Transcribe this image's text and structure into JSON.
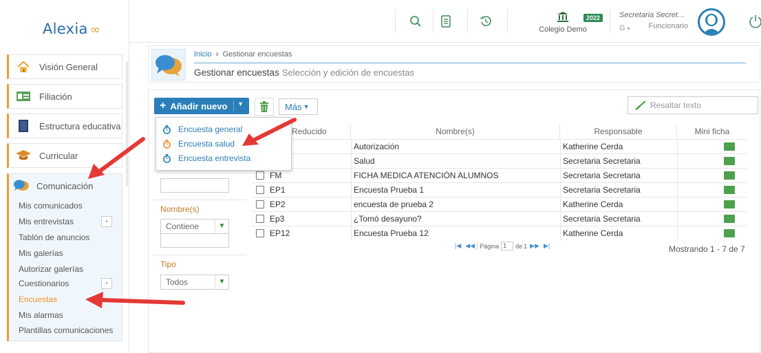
{
  "app": {
    "logo": "Alexia"
  },
  "sidebar": {
    "items": [
      {
        "label": "Visión General"
      },
      {
        "label": "Filiación"
      },
      {
        "label": "Estructura educativa"
      },
      {
        "label": "Curricular"
      }
    ],
    "comunicacion": {
      "label": "Comunicación",
      "subitems": [
        {
          "label": "Mis comunicados"
        },
        {
          "label": "Mis entrevistas"
        },
        {
          "label": "Tablón de anuncios"
        },
        {
          "label": "Mis galerías"
        },
        {
          "label": "Autorizar galerías"
        },
        {
          "label": "Cuestionarios"
        },
        {
          "label": "Encuestas"
        },
        {
          "label": "Mis alarmas"
        },
        {
          "label": "Plantillas comunicaciones"
        }
      ]
    }
  },
  "header": {
    "school_name": "Colegio Demo",
    "year": "2022",
    "user_name": "Secretaria Secretari...",
    "user_role": "Funcionario",
    "user_g": "G"
  },
  "breadcrumb": {
    "home": "Inicio",
    "current": "Gestionar encuestas"
  },
  "page": {
    "title": "Gestionar encuestas",
    "subtitle": "Selección y edición de encuestas"
  },
  "toolbar": {
    "add_label": "Añadir nuevo",
    "more_label": "Más",
    "highlight_placeholder": "Resaltar texto"
  },
  "dropdown": {
    "items": [
      {
        "label": "Encuesta general"
      },
      {
        "label": "Encuesta salud"
      },
      {
        "label": "Encuesta entrevista"
      }
    ]
  },
  "filters": {
    "nombre_label": "Nombre(s)",
    "nombre_op": "Contiene",
    "tipo_label": "Tipo",
    "tipo_value": "Todos"
  },
  "table": {
    "columns": [
      "Reducido",
      "Nombre(s)",
      "Responsable",
      "Mini ficha"
    ],
    "rows": [
      {
        "reducido": "",
        "nombre": "Autorización",
        "responsable": "Katherine Cerda"
      },
      {
        "reducido": "",
        "nombre": "Salud",
        "responsable": "Secretaria Secretaria"
      },
      {
        "reducido": "FM",
        "nombre": "FICHA MEDICA ATENCIÓN ALUMNOS",
        "responsable": "Secretaria Secretaria"
      },
      {
        "reducido": "EP1",
        "nombre": "Encuesta Prueba 1",
        "responsable": "Secretaria Secretaria"
      },
      {
        "reducido": "EP2",
        "nombre": "encuesta de prueba 2",
        "responsable": "Katherine Cerda"
      },
      {
        "reducido": "Ep3",
        "nombre": "¿Tomó desayuno?",
        "responsable": "Secretaria Secretaria"
      },
      {
        "reducido": "EP12",
        "nombre": "Encuesta Prueba 12",
        "responsable": "Katherine Cerda"
      }
    ]
  },
  "pager": {
    "page_label": "Página",
    "page": "1",
    "of_label": "de",
    "total": "1",
    "showing": "Mostrando 1 - 7 de 7"
  },
  "colors": {
    "accent": "#2a7fb8",
    "orange": "#f39a2e",
    "arrow": "#e53935"
  }
}
